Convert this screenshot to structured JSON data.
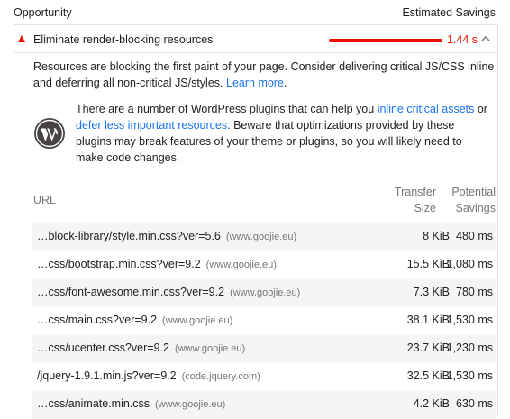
{
  "header": {
    "opportunity_label": "Opportunity",
    "estimated_savings_label": "Estimated Savings"
  },
  "audit": {
    "title": "Eliminate render-blocking resources",
    "savings": "1.44 s",
    "status_color": "#eb0f00",
    "description_text": "Resources are blocking the first paint of your page. Consider delivering critical JS/CSS inline and deferring all non-critical JS/styles.",
    "learn_more": "Learn more",
    "wordpress": {
      "icon": "wordpress-logo-icon",
      "text_1": "There are a number of WordPress plugins that can help you",
      "link_1": "inline critical assets",
      "text_2": "or",
      "link_2": "defer less important resources",
      "text_3": ". Beware that optimizations provided by these plugins may break features of your theme or plugins, so you will likely need to make code changes."
    },
    "table": {
      "col_url": "URL",
      "col_transfer_1": "Transfer",
      "col_transfer_2": "Size",
      "col_savings_1": "Potential",
      "col_savings_2": "Savings",
      "rows": [
        {
          "url": "…block-library/style.min.css?ver=5.6",
          "host": "(www.goojie.eu)",
          "size": "8 KiB",
          "savings": "480 ms"
        },
        {
          "url": "…css/bootstrap.min.css?ver=9.2",
          "host": "(www.goojie.eu)",
          "size": "15.5 KiB",
          "savings": "1,080 ms"
        },
        {
          "url": "…css/font-awesome.min.css?ver=9.2",
          "host": "(www.goojie.eu)",
          "size": "7.3 KiB",
          "savings": "780 ms"
        },
        {
          "url": "…css/main.css?ver=9.2",
          "host": "(www.goojie.eu)",
          "size": "38.1 KiB",
          "savings": "1,530 ms"
        },
        {
          "url": "…css/ucenter.css?ver=9.2",
          "host": "(www.goojie.eu)",
          "size": "23.7 KiB",
          "savings": "1,230 ms"
        },
        {
          "url": "/jquery-1.9.1.min.js?ver=9.2",
          "host": "(code.jquery.com)",
          "size": "32.5 KiB",
          "savings": "1,530 ms"
        },
        {
          "url": "…css/animate.min.css",
          "host": "(www.goojie.eu)",
          "size": "4.2 KiB",
          "savings": "630 ms"
        }
      ]
    }
  }
}
